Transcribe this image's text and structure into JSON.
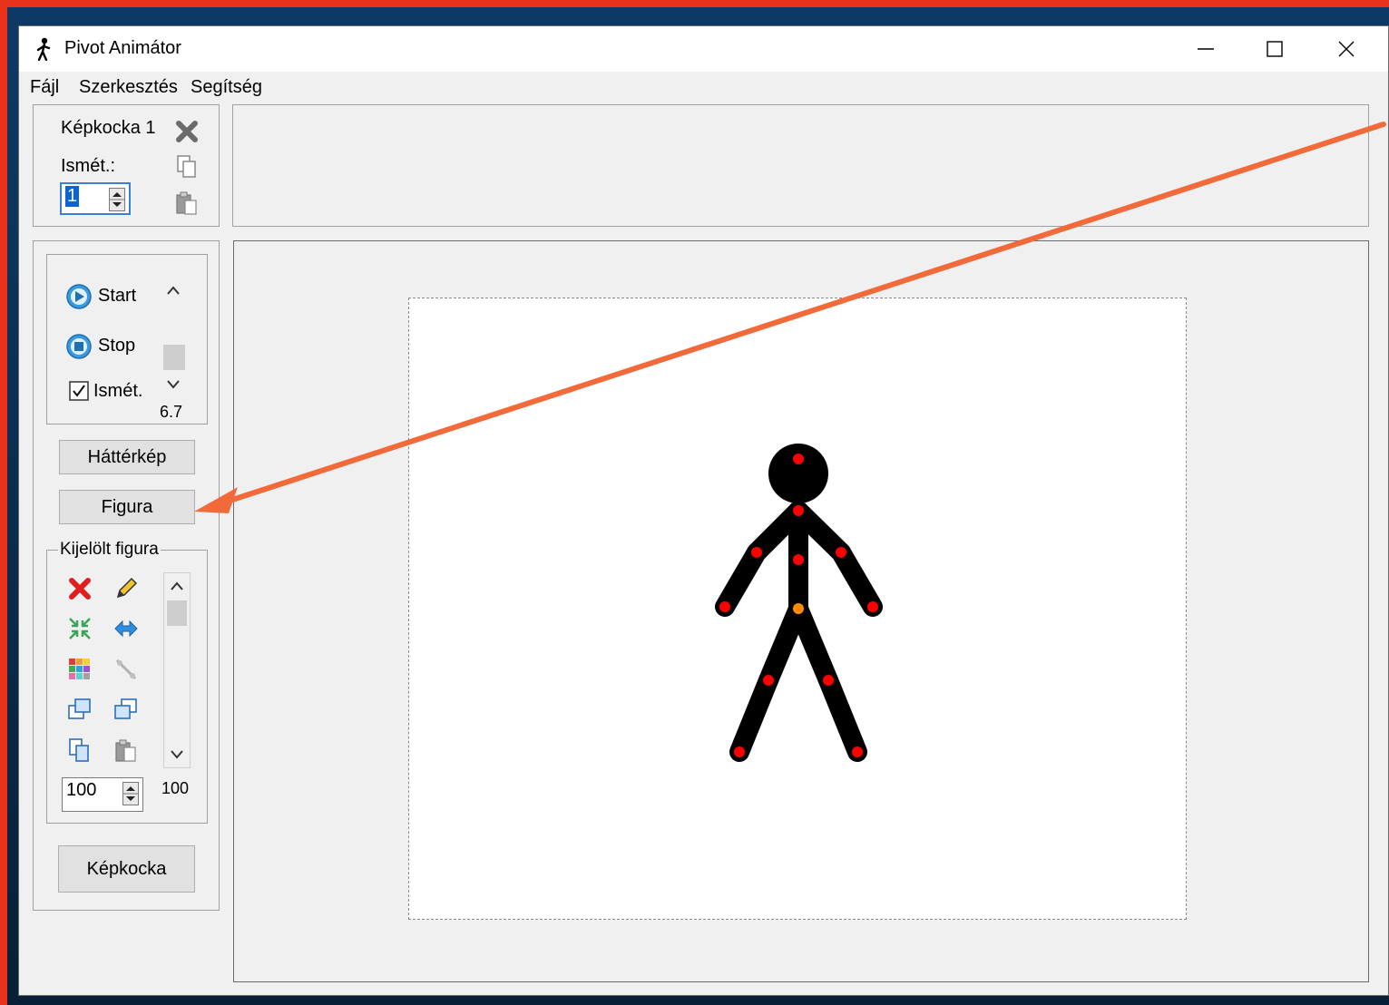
{
  "window": {
    "title": "Pivot Animátor"
  },
  "menu": {
    "items": [
      "Fájl",
      "Szerkesztés",
      "Segítség"
    ]
  },
  "frame_panel": {
    "frame_label": "Képkocka 1",
    "repeat_label": "Ismét.:",
    "repeat_value": "1"
  },
  "playback": {
    "start_label": "Start",
    "stop_label": "Stop",
    "loop_label": "Ismét.",
    "loop_checked": true,
    "speed_value": "6.7"
  },
  "buttons": {
    "background": "Háttérkép",
    "figure": "Figura",
    "frame": "Képkocka"
  },
  "selected_figure": {
    "group_label": "Kijelölt figura",
    "size_value": "100",
    "alpha_value": "100"
  },
  "colors": {
    "accent_arrow": "#f26a3a",
    "joint": "#ff0000",
    "center_joint": "#ff8c00",
    "border": "#e8321c"
  },
  "icons": {
    "window_controls": [
      "minimize-icon",
      "maximize-icon",
      "close-icon"
    ],
    "frame_tools": [
      "delete-frame-icon",
      "copy-frame-icon",
      "paste-frame-icon"
    ],
    "figure_tools": [
      "delete-icon",
      "edit-icon",
      "center-icon",
      "flip-icon",
      "color-icon",
      "join-icon",
      "bring-front-icon",
      "send-back-icon",
      "copy-icon",
      "paste-icon"
    ]
  }
}
